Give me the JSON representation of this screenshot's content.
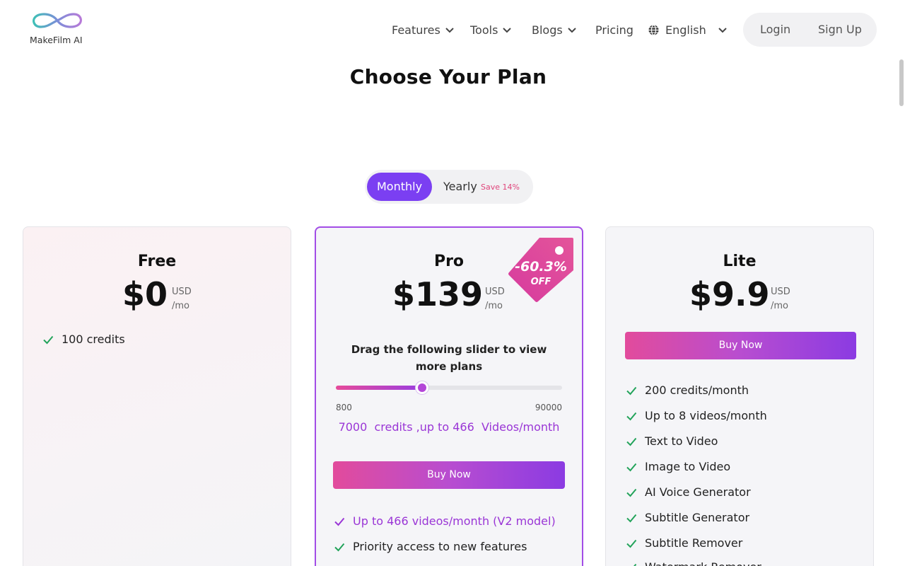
{
  "header": {
    "logo_text": "MakeFilm AI",
    "nav": [
      {
        "label": "Features",
        "has_dropdown": true
      },
      {
        "label": "Tools",
        "has_dropdown": true
      },
      {
        "label": "Blogs",
        "has_dropdown": true
      },
      {
        "label": "Pricing",
        "has_dropdown": false
      }
    ],
    "language": {
      "label": "English",
      "icon": "globe-icon"
    },
    "login_label": "Login",
    "signup_label": "Sign Up"
  },
  "page_title": "Choose Your Plan",
  "billing_toggle": {
    "monthly_label": "Monthly",
    "yearly_label": "Yearly",
    "yearly_save": "Save 14%",
    "selected": "Monthly"
  },
  "plans": {
    "free": {
      "name": "Free",
      "price": "$0",
      "currency": "USD",
      "period": "/mo",
      "features": [
        "100 credits"
      ]
    },
    "pro": {
      "name": "Pro",
      "price": "$139",
      "currency": "USD",
      "period": "/mo",
      "discount": "-60.3%",
      "discount_suffix": "OFF",
      "slider_title": "Drag the following slider to view more plans",
      "slider_min": "800",
      "slider_max": "90000",
      "slider_position": 0.38,
      "slider_summary": "7000  credits ,up to 466  Videos/month",
      "buy_label": "Buy Now",
      "features": [
        {
          "text": "Up to 466 videos/month (V2 model)",
          "highlight": true
        },
        {
          "text": "Priority access to new features",
          "highlight": false
        }
      ]
    },
    "lite": {
      "name": "Lite",
      "price": "$9.9",
      "currency": "USD",
      "period": "/mo",
      "buy_label": "Buy Now",
      "features": [
        "200 credits/month",
        "Up to 8 videos/month",
        "Text to Video",
        "Image to Video",
        "AI Voice Generator",
        "Subtitle Generator",
        "Subtitle Remover",
        "Watermark Remover"
      ]
    }
  },
  "colors": {
    "accent": "#7b3ff2",
    "check": "#22a35a",
    "highlight": "#9a36d6",
    "save": "#e0457b"
  }
}
